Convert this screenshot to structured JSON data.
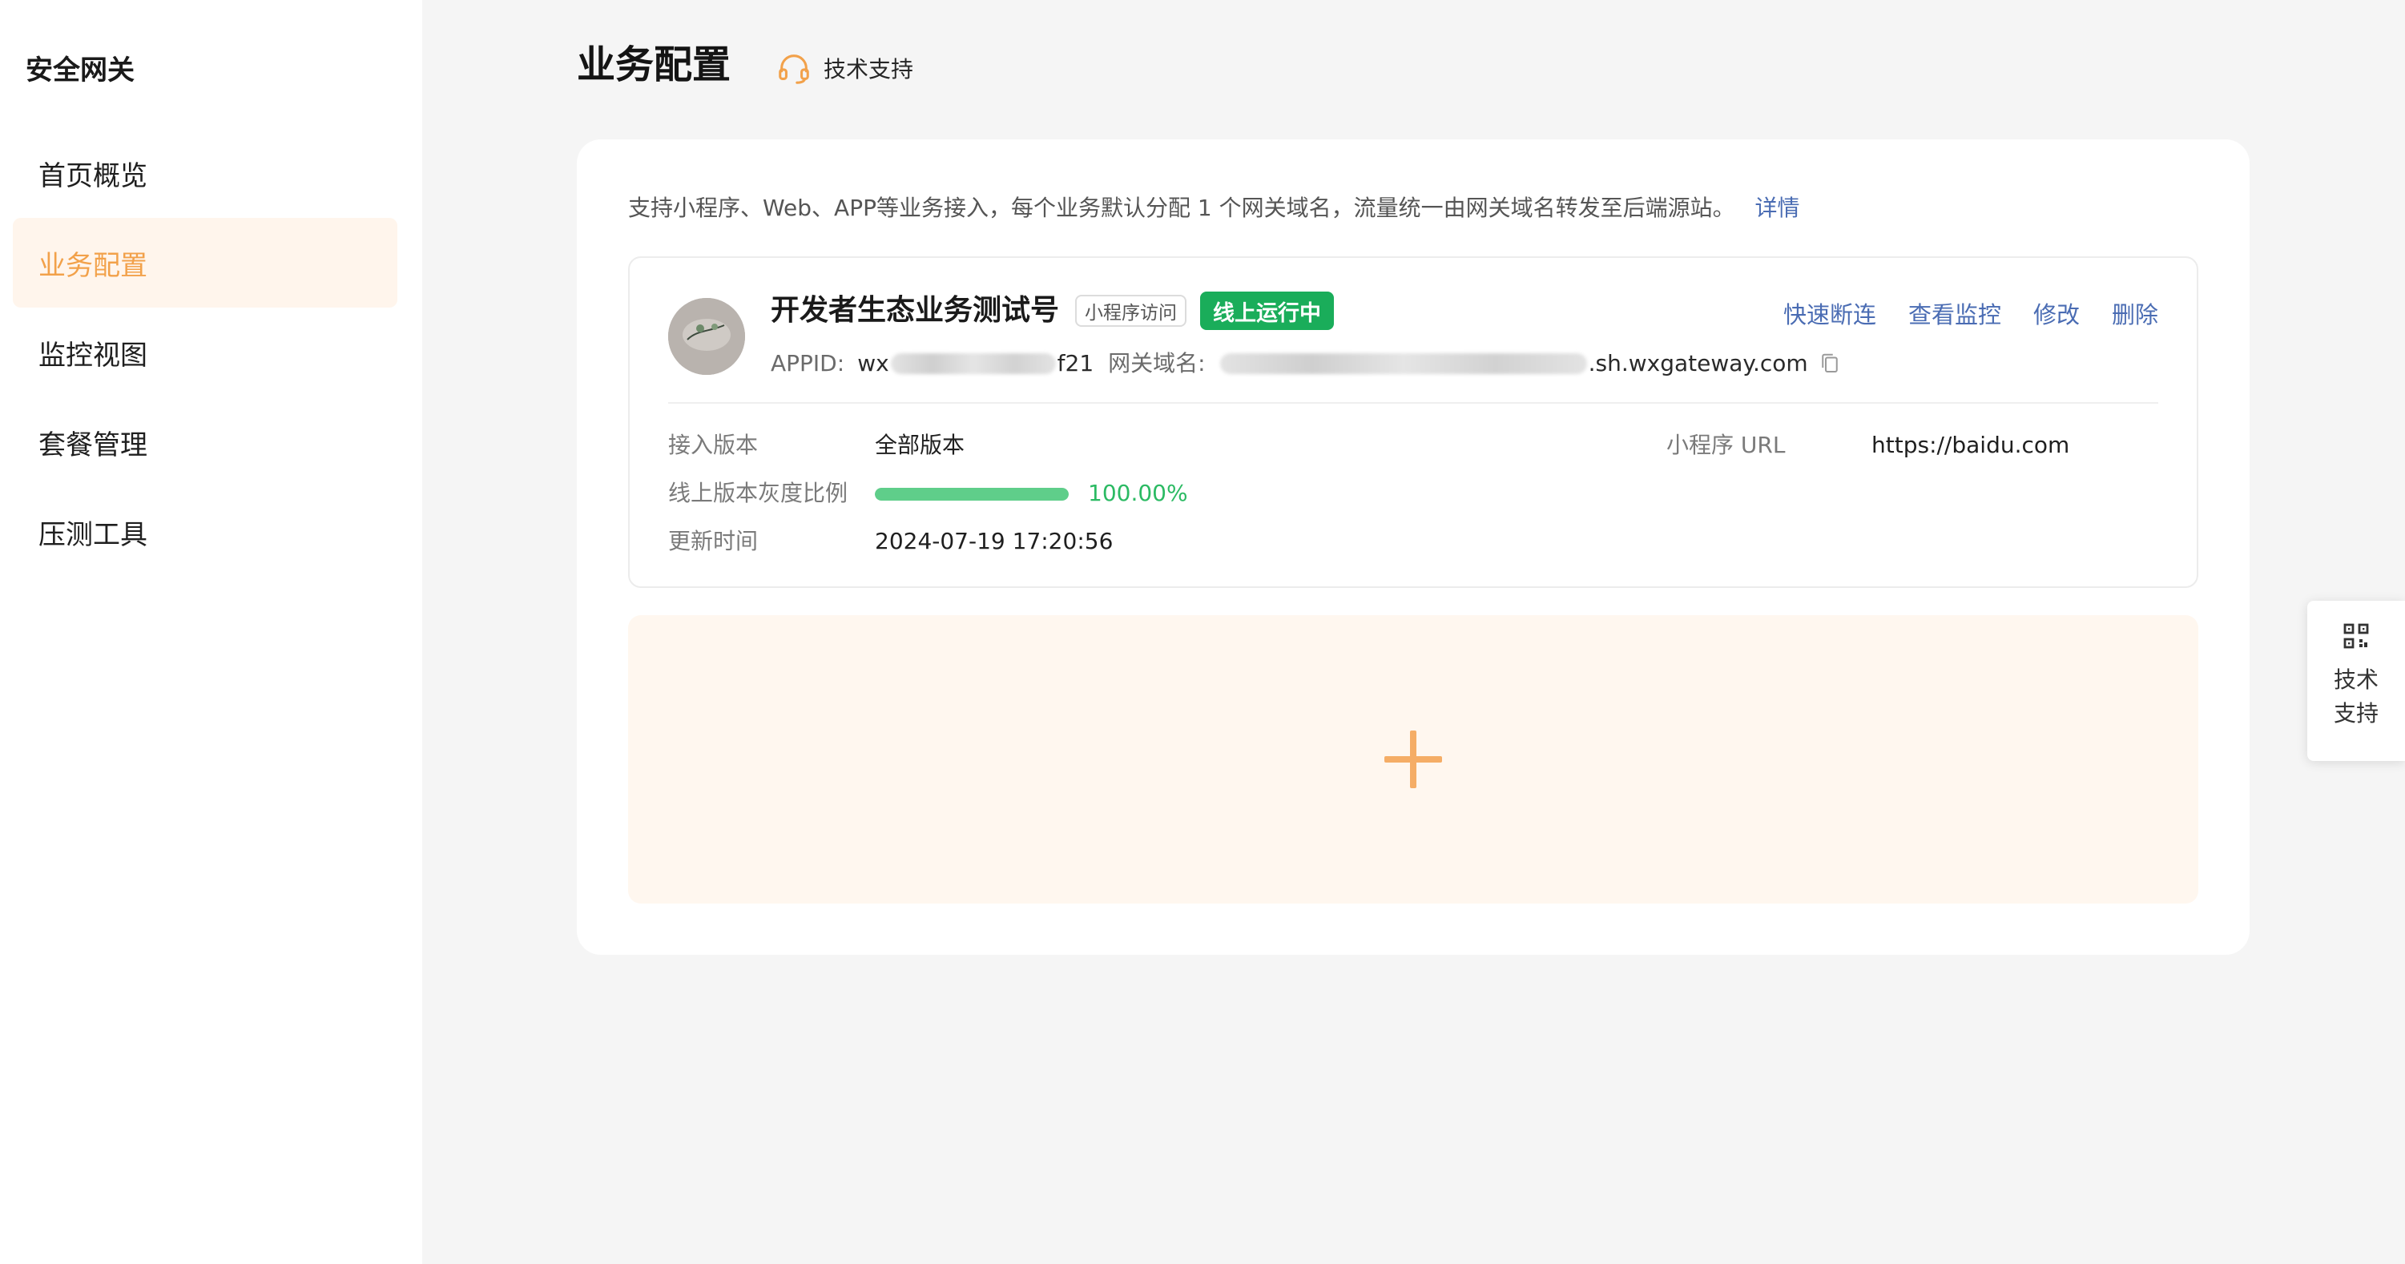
{
  "sidebar": {
    "brand": "安全网关",
    "items": [
      {
        "label": "首页概览"
      },
      {
        "label": "业务配置"
      },
      {
        "label": "监控视图"
      },
      {
        "label": "套餐管理"
      },
      {
        "label": "压测工具"
      }
    ],
    "active_index": 1
  },
  "header": {
    "title": "业务配置",
    "support_label": "技术支持"
  },
  "main": {
    "intro_text": "支持小程序、Web、APP等业务接入，每个业务默认分配 1 个网关域名，流量统一由网关域名转发至后端源站。",
    "intro_link": "详情",
    "business": {
      "name": "开发者生态业务测试号",
      "type_tag": "小程序访问",
      "status": "线上运行中",
      "actions": {
        "disconnect": "快速断连",
        "monitor": "查看监控",
        "edit": "修改",
        "delete": "删除"
      },
      "appid_label": "APPID:",
      "appid_prefix": "wx",
      "appid_suffix": "f21",
      "domain_label": "网关域名:",
      "domain_suffix": ".sh.wxgateway.com",
      "fields": {
        "version_label": "接入版本",
        "version_value": "全部版本",
        "gray_label": "线上版本灰度比例",
        "gray_percent": 100,
        "gray_text": "100.00%",
        "updated_label": "更新时间",
        "updated_value": "2024-07-19 17:20:56",
        "url_label": "小程序 URL",
        "url_value": "https://baidu.com"
      }
    },
    "add_label": "+"
  },
  "float_support": {
    "line1": "技术",
    "line2": "支持"
  },
  "colors": {
    "accent_orange": "#f2a14a",
    "status_green": "#1aad5a",
    "link_blue": "#4a6cb3",
    "progress_green": "#5fce8a"
  }
}
